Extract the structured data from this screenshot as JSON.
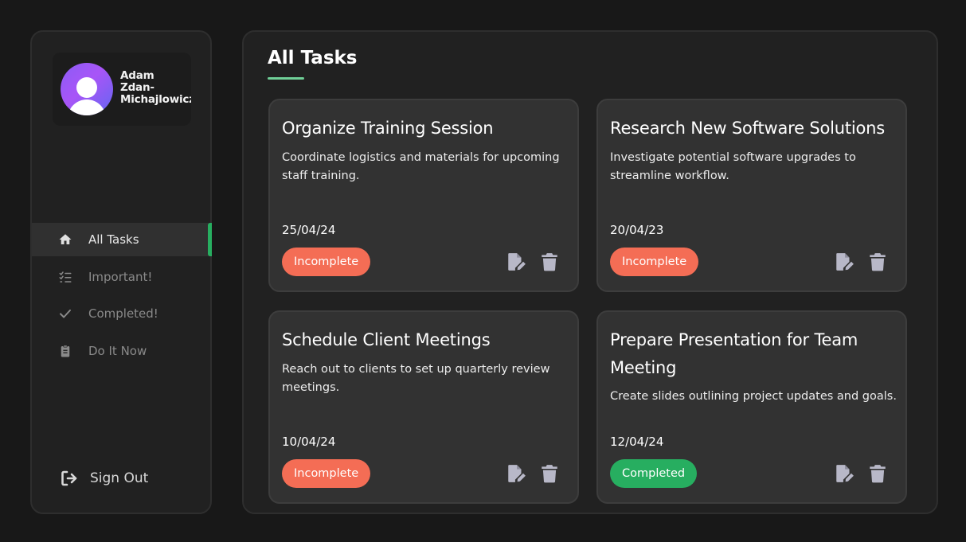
{
  "profile": {
    "name_lines": [
      "Adam",
      "Zdan-",
      "Michajlowicz"
    ]
  },
  "nav": {
    "items": [
      {
        "label": "All Tasks",
        "icon": "home-icon",
        "active": true
      },
      {
        "label": "Important!",
        "icon": "list-check-icon",
        "active": false
      },
      {
        "label": "Completed!",
        "icon": "checkmark-icon",
        "active": false
      },
      {
        "label": "Do It Now",
        "icon": "clipboard-icon",
        "active": false
      }
    ],
    "sign_out": "Sign Out"
  },
  "main": {
    "title": "All Tasks"
  },
  "tasks": [
    {
      "title": "Organize Training Session",
      "description": "Coordinate logistics and materials for upcoming staff training.",
      "date": "25/04/24",
      "status": "Incomplete"
    },
    {
      "title": "Research New Software Solutions",
      "description": "Investigate potential software upgrades to streamline workflow.",
      "date": "20/04/23",
      "status": "Incomplete"
    },
    {
      "title": "Schedule Client Meetings",
      "description": "Reach out to clients to set up quarterly review meetings.",
      "date": "10/04/24",
      "status": "Incomplete"
    },
    {
      "title": "Prepare Presentation for Team Meeting",
      "description": "Create slides outlining project updates and goals.",
      "date": "12/04/24",
      "status": "Completed"
    }
  ],
  "colors": {
    "accent": "#27ae60",
    "incomplete": "#f46d55",
    "completed": "#27ae60",
    "underline": "#6fcf97",
    "icon": "#b8b8c8"
  }
}
